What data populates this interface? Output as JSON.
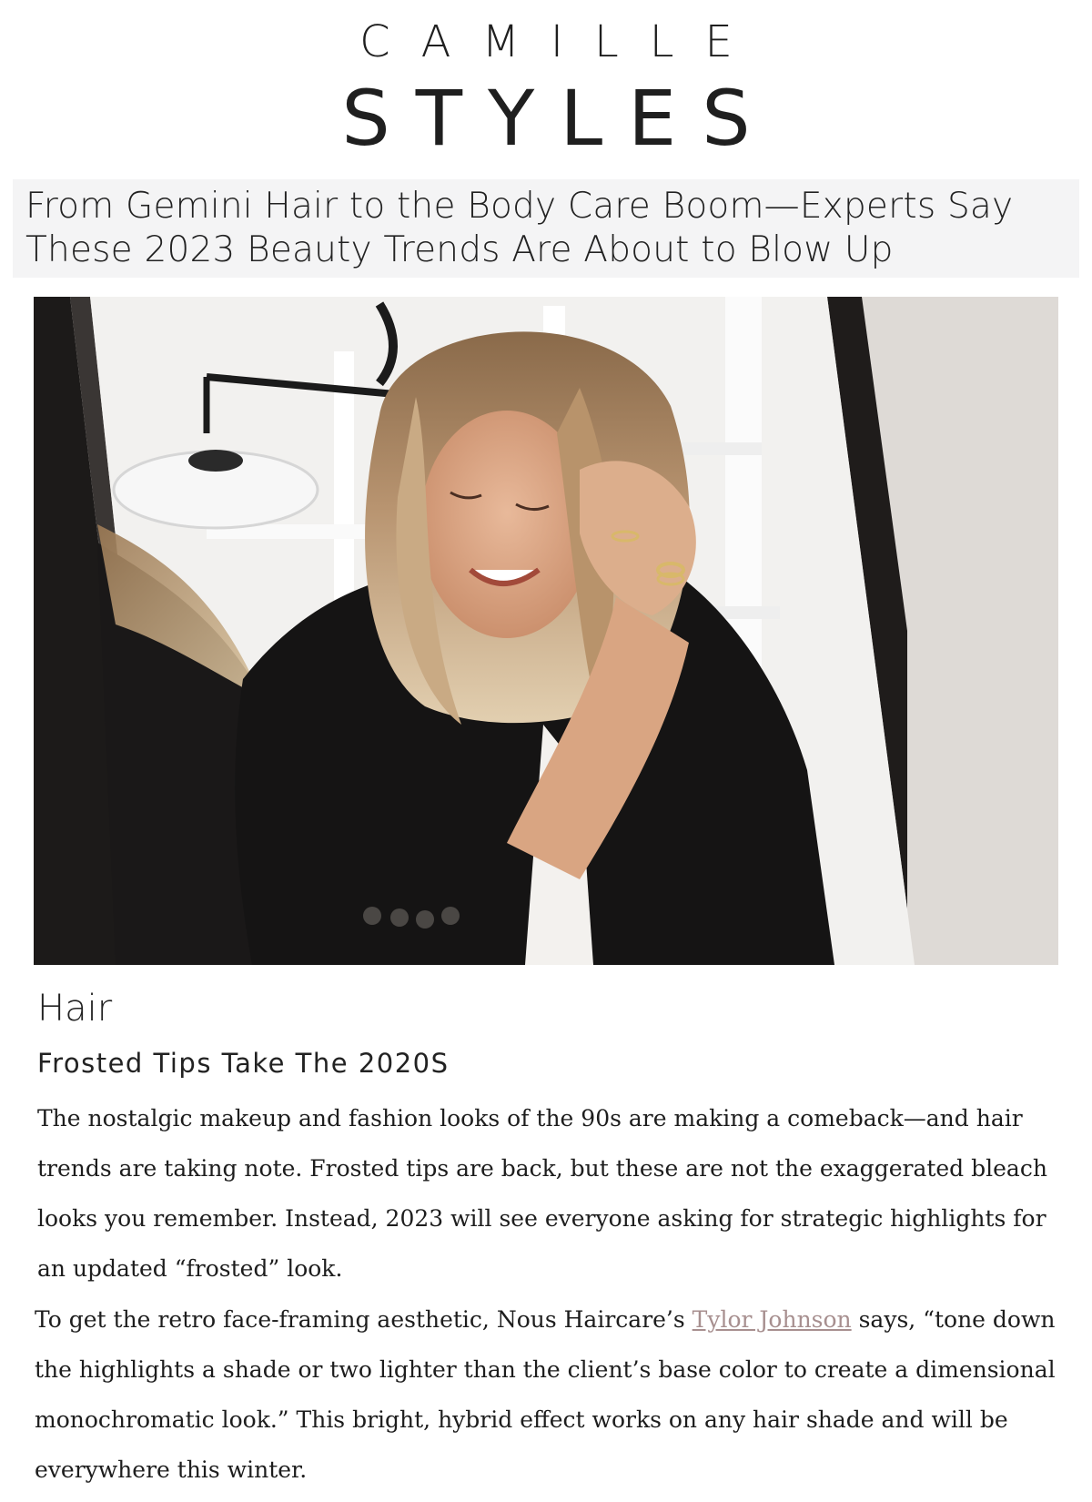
{
  "brand": {
    "top": "CAMILLE",
    "bottom": "STYLES"
  },
  "article": {
    "headline": "From Gemini Hair to the Body Care Boom—Experts Say These 2023 Beauty Trends Are About to Blow Up",
    "section_title": "Hair",
    "subsection_title": "Frosted Tips Take The 2020S",
    "paragraph1": "The nostalgic makeup and fashion looks of the 90s are making a comeback—and hair trends are taking note. Frosted tips are back, but these are not the exaggerated bleach looks you remember. Instead, 2023 will see everyone asking for strategic highlights for an updated “frosted” look.",
    "paragraph2_before": "To get the retro face-framing aesthetic, Nous Haircare’s ",
    "paragraph2_link": "Tylor Johnson",
    "paragraph2_after": " says, “tone down the highlights a shade or two lighter than the client’s base color to create a dimensional monochromatic look.” This bright, hybrid effect works on any hair shade and will be everywhere this winter."
  },
  "colors": {
    "link": "#a78f8f",
    "headline_bg": "#f4f4f5",
    "text": "#1d1d1d"
  }
}
